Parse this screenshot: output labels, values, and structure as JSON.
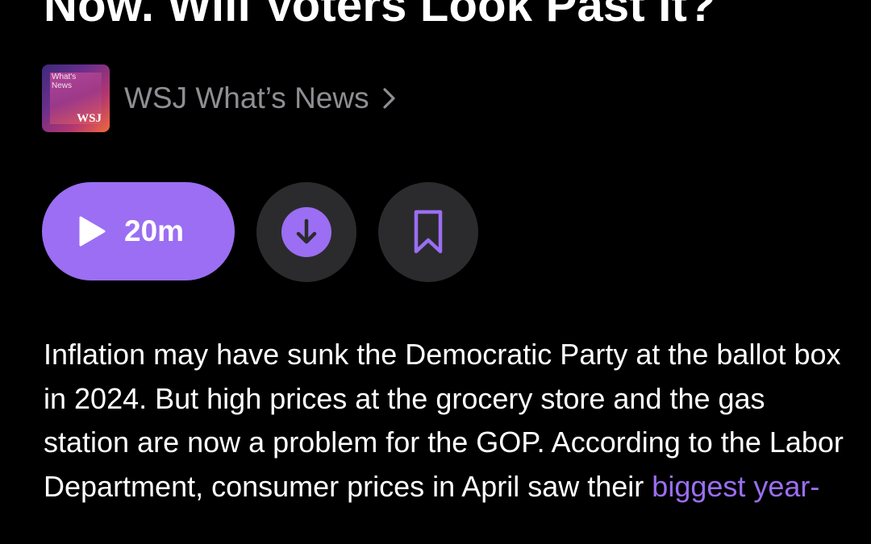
{
  "episode": {
    "title_visible_line": "Now. Will Voters Look Past It?"
  },
  "show": {
    "name": "WSJ What’s News",
    "chevron": "chevron-right-icon",
    "artwork": {
      "line1": "What's",
      "line2": "News",
      "logo": "WSJ"
    }
  },
  "actions": {
    "play_icon": "play-icon",
    "duration": "20m",
    "download_icon": "download-icon",
    "bookmark_icon": "bookmark-icon"
  },
  "description": {
    "text": "Inflation may have sunk the Democratic Party at the ballot box in 2024. But high prices at the grocery store and the gas station are now a problem for the GOP. According to the Labor Department, consumer prices in April saw their ",
    "link_text": "biggest year-"
  },
  "colors": {
    "background": "#000000",
    "accent": "#9b6ef3",
    "secondary_text": "#8e8e93",
    "button_surface": "#2b2b2d"
  }
}
